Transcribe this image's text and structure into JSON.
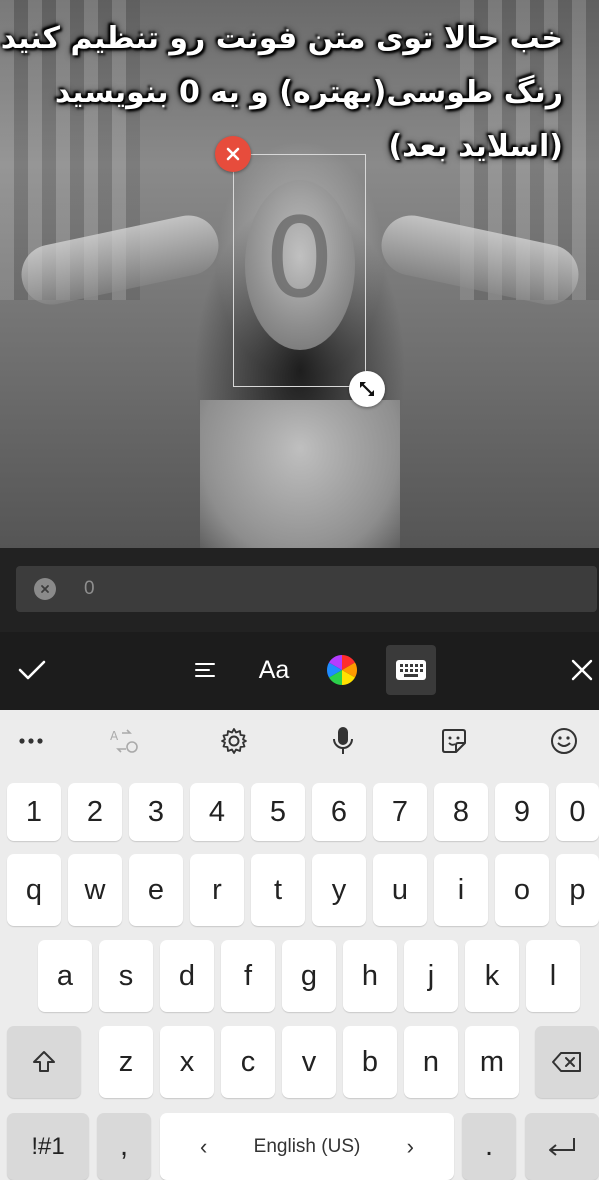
{
  "caption": {
    "line1": "خب حالا توی متن فونت رو تنظیم کنید",
    "line2": "رنگ طوسی(بهتره) و یه 0 بنویسید",
    "line3": "(اسلاید بعد)"
  },
  "canvas": {
    "text_element_value": "0"
  },
  "text_input": {
    "value": "0"
  },
  "toolbar": {
    "font_label": "Aa"
  },
  "keyboard": {
    "number_row": [
      "1",
      "2",
      "3",
      "4",
      "5",
      "6",
      "7",
      "8",
      "9",
      "0"
    ],
    "row1": [
      "q",
      "w",
      "e",
      "r",
      "t",
      "y",
      "u",
      "i",
      "o",
      "p"
    ],
    "row2": [
      "a",
      "s",
      "d",
      "f",
      "g",
      "h",
      "j",
      "k",
      "l"
    ],
    "row3": [
      "z",
      "x",
      "c",
      "v",
      "b",
      "n",
      "m"
    ],
    "symbols_label": "!#1",
    "comma_label": ",",
    "period_label": ".",
    "space_label": "English (US)",
    "space_left_arrow": "‹",
    "space_right_arrow": "›"
  },
  "colors": {
    "delete_handle": "#e74c3c",
    "toolbar_bg": "#1c1c1c",
    "keyboard_bg": "#ececec"
  }
}
